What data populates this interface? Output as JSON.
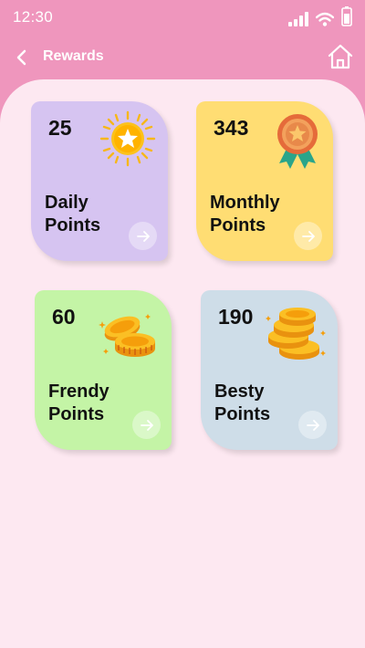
{
  "status_bar": {
    "time": "12:30"
  },
  "header": {
    "title": "Rewards"
  },
  "colors": {
    "header_bg": "#ef96bd",
    "page_bg": "#fde8f1",
    "card_daily": "#d6c4f1",
    "card_monthly": "#ffdd73",
    "card_frendy": "#c4f4a6",
    "card_besty": "#cedde8"
  },
  "cards": [
    {
      "value": "25",
      "label_line1": "Daily",
      "label_line2": "Points",
      "icon": "sun-star-icon"
    },
    {
      "value": "343",
      "label_line1": "Monthly",
      "label_line2": "Points",
      "icon": "medal-icon"
    },
    {
      "value": "60",
      "label_line1": "Frendy",
      "label_line2": "Points",
      "icon": "coins-icon"
    },
    {
      "value": "190",
      "label_line1": "Besty",
      "label_line2": "Points",
      "icon": "coin-stack-icon"
    }
  ]
}
